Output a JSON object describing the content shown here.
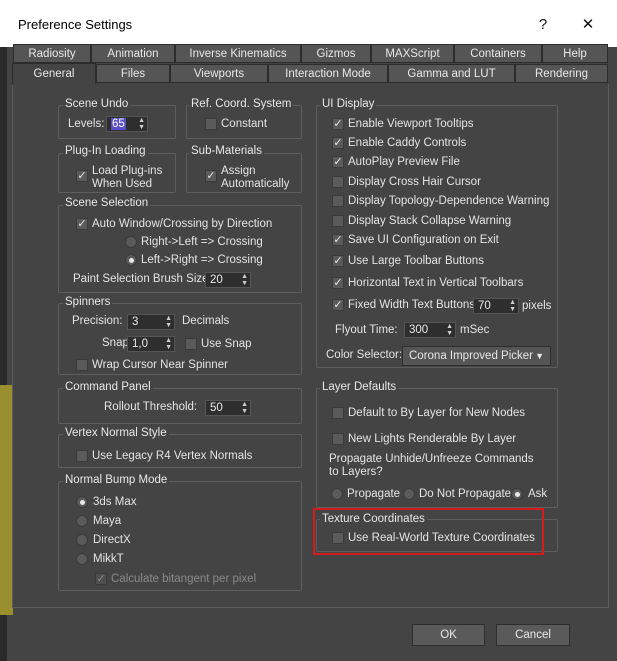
{
  "window": {
    "title": "Preference Settings",
    "help": "?",
    "close": "✕"
  },
  "tabs_row1": [
    "Radiosity",
    "Animation",
    "Inverse Kinematics",
    "Gizmos",
    "MAXScript",
    "Containers",
    "Help"
  ],
  "tabs_row2": [
    "General",
    "Files",
    "Viewports",
    "Interaction Mode",
    "Gamma and LUT",
    "Rendering"
  ],
  "scene_undo": {
    "title": "Scene Undo",
    "levels_label": "Levels:",
    "levels_value": "65"
  },
  "ref_coord": {
    "title": "Ref. Coord. System",
    "constant": "Constant"
  },
  "plugin_loading": {
    "title": "Plug-In Loading",
    "load_line1": "Load Plug-ins",
    "load_line2": "When Used"
  },
  "sub_materials": {
    "title": "Sub-Materials",
    "assign_line1": "Assign",
    "assign_line2": "Automatically"
  },
  "scene_selection": {
    "title": "Scene Selection",
    "auto_window": "Auto Window/Crossing by Direction",
    "rl_crossing": "Right->Left => Crossing",
    "lr_crossing": "Left->Right => Crossing",
    "brush_label": "Paint Selection Brush Size",
    "brush_value": "20"
  },
  "spinners": {
    "title": "Spinners",
    "precision_label": "Precision:",
    "precision_value": "3",
    "decimals": "Decimals",
    "snap_label": "Snap:",
    "snap_value": "1,0",
    "use_snap": "Use Snap",
    "wrap_cursor": "Wrap Cursor Near Spinner"
  },
  "command_panel": {
    "title": "Command Panel",
    "rollout_label": "Rollout Threshold:",
    "rollout_value": "50"
  },
  "vertex_normal": {
    "title": "Vertex Normal Style",
    "legacy": "Use Legacy R4 Vertex Normals"
  },
  "normal_bump": {
    "title": "Normal Bump Mode",
    "options": [
      "3ds Max",
      "Maya",
      "DirectX",
      "MikkT"
    ],
    "bitangent": "Calculate bitangent per pixel"
  },
  "ui_display": {
    "title": "UI Display",
    "items": [
      "Enable Viewport Tooltips",
      "Enable Caddy Controls",
      "AutoPlay Preview File",
      "Display Cross Hair Cursor",
      "Display Topology-Dependence Warning",
      "Display Stack Collapse Warning",
      "Save UI Configuration on Exit",
      "Use Large Toolbar Buttons",
      "Horizontal Text in Vertical Toolbars",
      "Fixed Width Text Buttons:"
    ],
    "fixed_width_value": "70",
    "pixels": "pixels",
    "flyout_label": "Flyout Time:",
    "flyout_value": "300",
    "msec": "mSec",
    "color_selector_label": "Color Selector:",
    "color_selector_value": "Corona Improved Picker"
  },
  "layer_defaults": {
    "title": "Layer Defaults",
    "default_bylayer": "Default to By Layer for New Nodes",
    "new_lights": "New Lights Renderable By Layer",
    "propagate_q1": "Propagate Unhide/Unfreeze Commands",
    "propagate_q2": "to Layers?",
    "propagate": "Propagate",
    "do_not_propagate": "Do Not Propagate",
    "ask": "Ask"
  },
  "texture_coords": {
    "title": "Texture Coordinates",
    "real_world": "Use Real-World Texture Coordinates"
  },
  "footer": {
    "ok": "OK",
    "cancel": "Cancel"
  },
  "colors": {
    "highlight": "#d41c1c",
    "dialog_bg": "#444444",
    "selection": "#5a4fc8"
  }
}
